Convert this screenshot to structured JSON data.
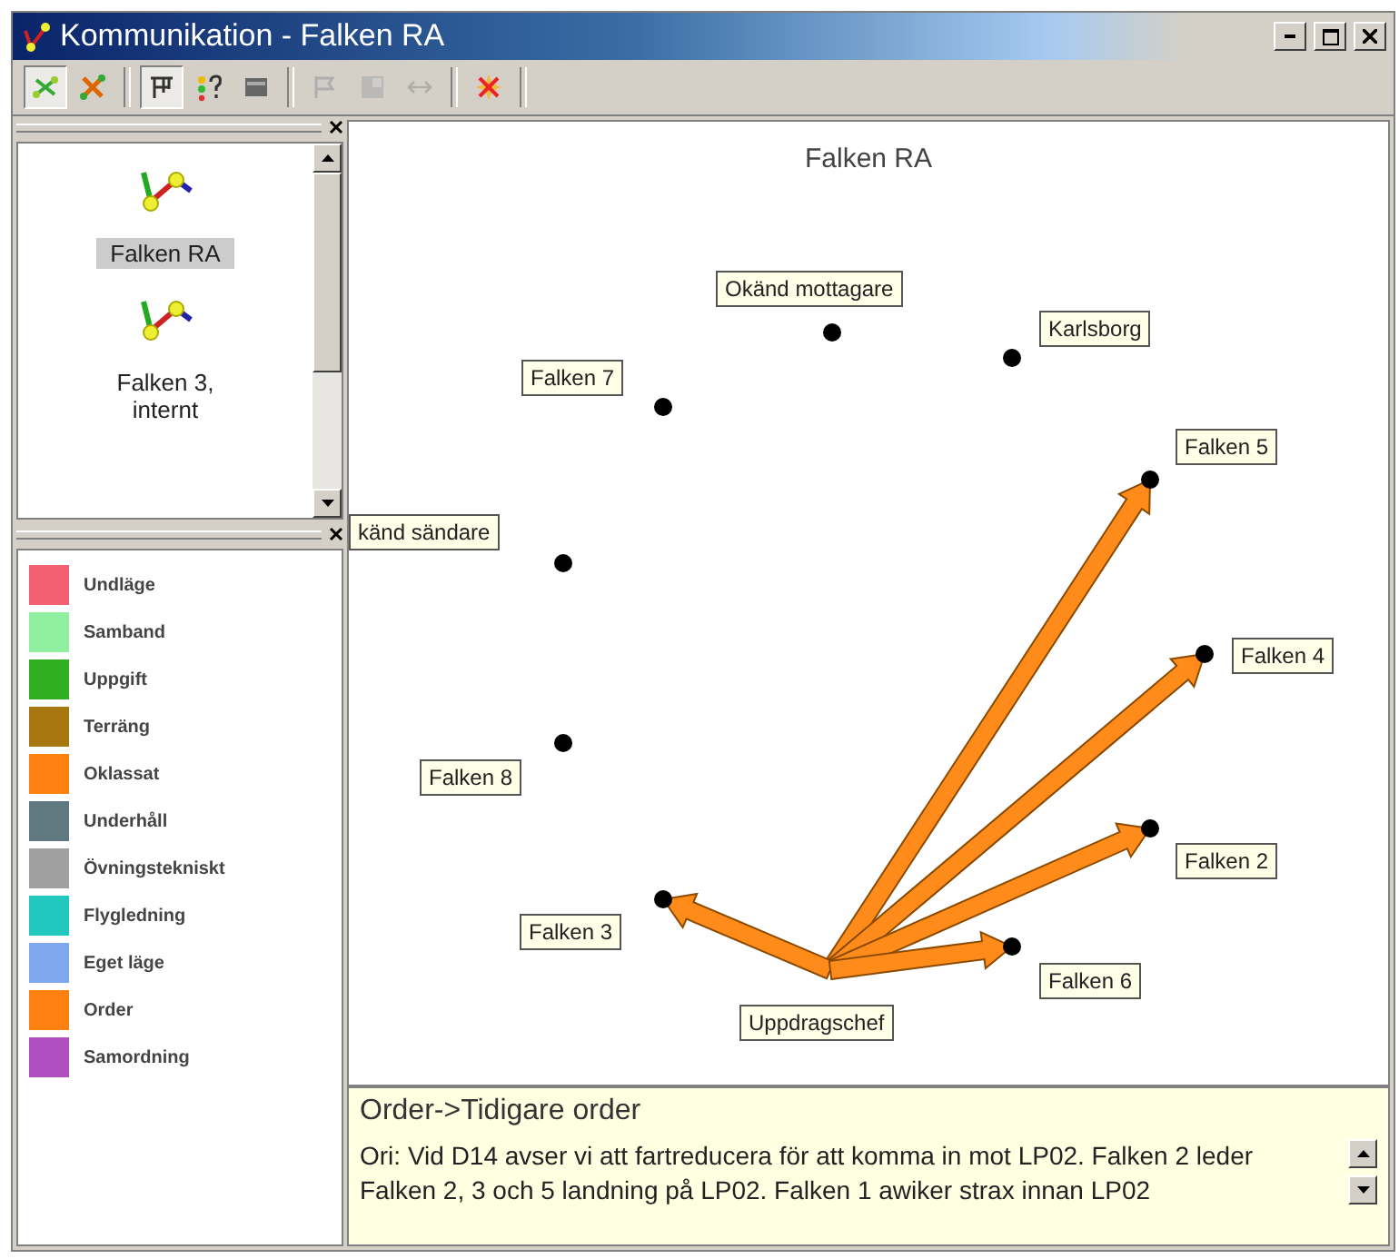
{
  "window": {
    "title": "Kommunikation - Falken RA"
  },
  "toolbar": [
    {
      "pressed": true,
      "disabled": false
    },
    {
      "pressed": false,
      "disabled": false
    },
    {
      "pressed": true,
      "disabled": false
    },
    {
      "pressed": false,
      "disabled": false
    },
    {
      "pressed": false,
      "disabled": false
    },
    {
      "pressed": false,
      "disabled": true
    },
    {
      "pressed": false,
      "disabled": true
    },
    {
      "pressed": false,
      "disabled": true
    },
    {
      "pressed": false,
      "disabled": false
    }
  ],
  "units": [
    {
      "label": "Falken RA",
      "selected": true
    },
    {
      "label": "Falken 3, internt",
      "selected": false
    }
  ],
  "legend": [
    {
      "label": "Undläge",
      "color": "#f06070"
    },
    {
      "label": "Samband",
      "color": "#90f0a0"
    },
    {
      "label": "Uppgift",
      "color": "#30b020"
    },
    {
      "label": "Terräng",
      "color": "#a87810"
    },
    {
      "label": "Oklassat",
      "color": "#ff8010"
    },
    {
      "label": "Underhåll",
      "color": "#607880"
    },
    {
      "label": "Övningstekniskt",
      "color": "#a0a0a0"
    },
    {
      "label": "Flygledning",
      "color": "#20c8c0"
    },
    {
      "label": "Eget läge",
      "color": "#80a8f0"
    },
    {
      "label": "Order",
      "color": "#ff8010"
    },
    {
      "label": "Samordning",
      "color": "#b050c0"
    }
  ],
  "diagram": {
    "title": "Falken RA",
    "nodes": [
      {
        "label": "Okänd mottagare",
        "kind": "plain"
      },
      {
        "label": "Karlsborg",
        "kind": "plain"
      },
      {
        "label": "Falken 7",
        "kind": "plain"
      },
      {
        "label": "Falken 5",
        "kind": "target"
      },
      {
        "label": "känd sändare",
        "kind": "plain"
      },
      {
        "label": "Falken 4",
        "kind": "target"
      },
      {
        "label": "Falken 8",
        "kind": "plain"
      },
      {
        "label": "Falken 2",
        "kind": "target"
      },
      {
        "label": "Falken 3",
        "kind": "target"
      },
      {
        "label": "Falken 6",
        "kind": "target"
      },
      {
        "label": "Uppdragschef",
        "kind": "source"
      }
    ]
  },
  "info": {
    "title": "Order->Tidigare order",
    "text": "Ori: Vid D14 avser vi att fartreducera för att komma in mot LP02. Falken 2 leder Falken 2, 3 och 5 landning på LP02. Falken 1 awiker strax innan LP02"
  }
}
